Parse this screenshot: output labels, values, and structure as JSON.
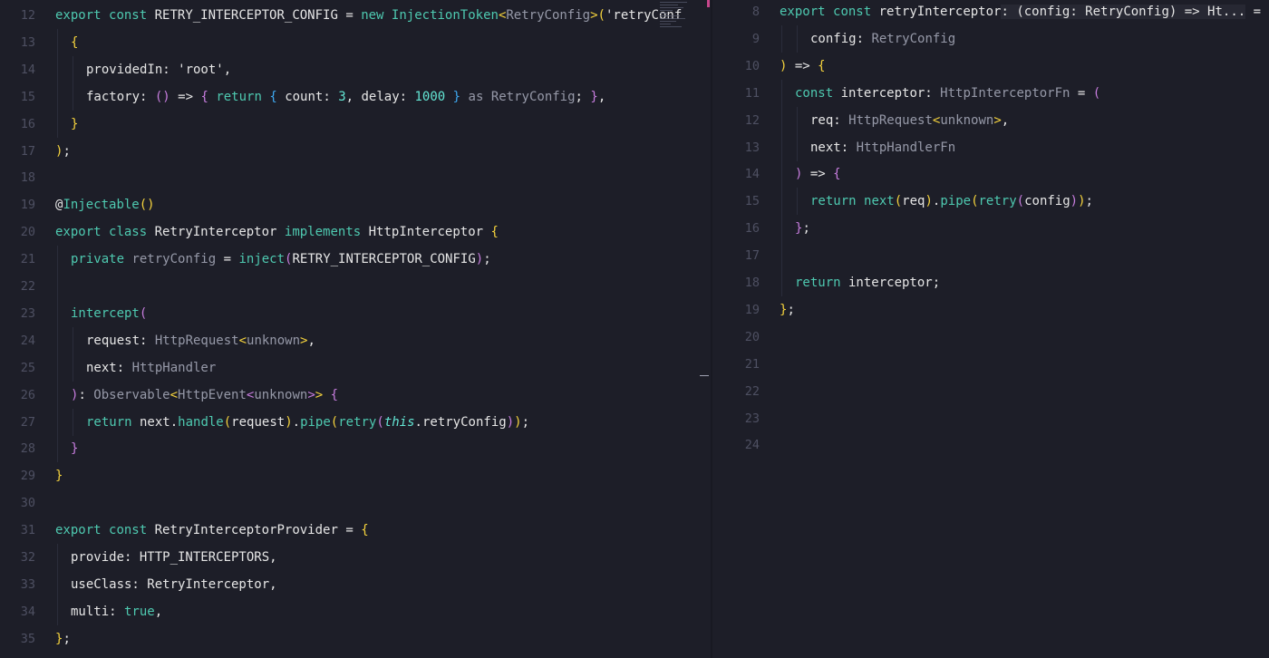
{
  "left_editor": {
    "lines": [
      {
        "n": "12",
        "ind": 0,
        "toks": [
          [
            "k",
            "export"
          ],
          [
            "v",
            " "
          ],
          [
            "k",
            "const"
          ],
          [
            "v",
            " RETRY_INTERCEPTOR_CONFIG = "
          ],
          [
            "k",
            "new"
          ],
          [
            "v",
            " "
          ],
          [
            "d",
            "InjectionToken"
          ],
          [
            "b1",
            "<"
          ],
          [
            "t",
            "RetryConfig"
          ],
          [
            "b1",
            ">"
          ],
          [
            "b1",
            "("
          ],
          [
            "v",
            "'retryConf"
          ]
        ]
      },
      {
        "n": "13",
        "ind": 1,
        "toks": [
          [
            "b1",
            "{"
          ]
        ]
      },
      {
        "n": "14",
        "ind": 2,
        "toks": [
          [
            "v",
            "providedIn: 'root',"
          ]
        ]
      },
      {
        "n": "15",
        "ind": 2,
        "toks": [
          [
            "v",
            "factory: "
          ],
          [
            "b2",
            "()"
          ],
          [
            "v",
            " => "
          ],
          [
            "b2",
            "{"
          ],
          [
            "v",
            " "
          ],
          [
            "k",
            "return"
          ],
          [
            "v",
            " "
          ],
          [
            "b3",
            "{"
          ],
          [
            "v",
            " count: "
          ],
          [
            "n",
            "3"
          ],
          [
            "v",
            ", delay: "
          ],
          [
            "n",
            "1000"
          ],
          [
            "v",
            " "
          ],
          [
            "b3",
            "}"
          ],
          [
            "v",
            " "
          ],
          [
            "t",
            "as RetryConfig"
          ],
          [
            "v",
            "; "
          ],
          [
            "b2",
            "}"
          ],
          [
            "v",
            ","
          ]
        ]
      },
      {
        "n": "16",
        "ind": 1,
        "toks": [
          [
            "b1",
            "}"
          ]
        ]
      },
      {
        "n": "17",
        "ind": 0,
        "toks": [
          [
            "b1",
            ")"
          ],
          [
            "v",
            ";"
          ]
        ]
      },
      {
        "n": "18",
        "ind": 0,
        "toks": []
      },
      {
        "n": "19",
        "ind": 0,
        "toks": [
          [
            "v",
            "@"
          ],
          [
            "d",
            "Injectable"
          ],
          [
            "b1",
            "()"
          ]
        ]
      },
      {
        "n": "20",
        "ind": 0,
        "toks": [
          [
            "k",
            "export"
          ],
          [
            "v",
            " "
          ],
          [
            "k",
            "class"
          ],
          [
            "v",
            " RetryInterceptor "
          ],
          [
            "k",
            "implements"
          ],
          [
            "v",
            " HttpInterceptor "
          ],
          [
            "b1",
            "{"
          ]
        ]
      },
      {
        "n": "21",
        "ind": 1,
        "toks": [
          [
            "k",
            "private"
          ],
          [
            "v",
            " "
          ],
          [
            "t",
            "retryConfig"
          ],
          [
            "v",
            " = "
          ],
          [
            "f",
            "inject"
          ],
          [
            "b2",
            "("
          ],
          [
            "v",
            "RETRY_INTERCEPTOR_CONFIG"
          ],
          [
            "b2",
            ")"
          ],
          [
            "v",
            ";"
          ]
        ]
      },
      {
        "n": "22",
        "ind": 1,
        "toks": []
      },
      {
        "n": "23",
        "ind": 1,
        "toks": [
          [
            "f",
            "intercept"
          ],
          [
            "b2",
            "("
          ]
        ]
      },
      {
        "n": "24",
        "ind": 2,
        "toks": [
          [
            "v",
            "request: "
          ],
          [
            "t",
            "HttpRequest"
          ],
          [
            "b1",
            "<"
          ],
          [
            "t",
            "unknown"
          ],
          [
            "b1",
            ">"
          ],
          [
            "v",
            ","
          ]
        ]
      },
      {
        "n": "25",
        "ind": 2,
        "toks": [
          [
            "v",
            "next: "
          ],
          [
            "t",
            "HttpHandler"
          ]
        ]
      },
      {
        "n": "26",
        "ind": 1,
        "toks": [
          [
            "b2",
            ")"
          ],
          [
            "v",
            ": "
          ],
          [
            "t",
            "Observable"
          ],
          [
            "b1",
            "<"
          ],
          [
            "t",
            "HttpEvent"
          ],
          [
            "b2",
            "<"
          ],
          [
            "t",
            "unknown"
          ],
          [
            "b2",
            ">"
          ],
          [
            "b1",
            ">"
          ],
          [
            "v",
            " "
          ],
          [
            "b2",
            "{"
          ]
        ]
      },
      {
        "n": "27",
        "ind": 2,
        "toks": [
          [
            "k",
            "return"
          ],
          [
            "v",
            " next."
          ],
          [
            "f",
            "handle"
          ],
          [
            "b1",
            "("
          ],
          [
            "v",
            "request"
          ],
          [
            "b1",
            ")"
          ],
          [
            "v",
            "."
          ],
          [
            "f",
            "pipe"
          ],
          [
            "b1",
            "("
          ],
          [
            "f",
            "retry"
          ],
          [
            "b2",
            "("
          ],
          [
            "it",
            "this"
          ],
          [
            "v",
            ".retryConfig"
          ],
          [
            "b2",
            ")"
          ],
          [
            "b1",
            ")"
          ],
          [
            "v",
            ";"
          ]
        ]
      },
      {
        "n": "28",
        "ind": 1,
        "toks": [
          [
            "b2",
            "}"
          ]
        ]
      },
      {
        "n": "29",
        "ind": 0,
        "toks": [
          [
            "b1",
            "}"
          ]
        ]
      },
      {
        "n": "30",
        "ind": 0,
        "toks": []
      },
      {
        "n": "31",
        "ind": 0,
        "toks": [
          [
            "k",
            "export"
          ],
          [
            "v",
            " "
          ],
          [
            "k",
            "const"
          ],
          [
            "v",
            " RetryInterceptorProvider = "
          ],
          [
            "b1",
            "{"
          ]
        ]
      },
      {
        "n": "32",
        "ind": 1,
        "toks": [
          [
            "v",
            "provide: HTTP_INTERCEPTORS,"
          ]
        ]
      },
      {
        "n": "33",
        "ind": 1,
        "toks": [
          [
            "v",
            "useClass: RetryInterceptor,"
          ]
        ]
      },
      {
        "n": "34",
        "ind": 1,
        "toks": [
          [
            "v",
            "multi: "
          ],
          [
            "k",
            "true"
          ],
          [
            "v",
            ","
          ]
        ]
      },
      {
        "n": "35",
        "ind": 0,
        "toks": [
          [
            "b1",
            "}"
          ],
          [
            "v",
            ";"
          ]
        ]
      }
    ]
  },
  "right_editor": {
    "lines": [
      {
        "n": "8",
        "ind": 0,
        "toks": [
          [
            "k",
            "export"
          ],
          [
            "v",
            " "
          ],
          [
            "k",
            "const"
          ],
          [
            "v",
            " retryInterceptor"
          ],
          [
            "hint",
            ": (config: RetryConfig) => Ht..."
          ],
          [
            "v",
            " = "
          ],
          [
            "b1",
            "("
          ]
        ]
      },
      {
        "n": "9",
        "ind": 2,
        "toks": [
          [
            "v",
            "config: "
          ],
          [
            "t",
            "RetryConfig"
          ]
        ]
      },
      {
        "n": "10",
        "ind": 0,
        "toks": [
          [
            "b1",
            ")"
          ],
          [
            "v",
            " => "
          ],
          [
            "b1",
            "{"
          ]
        ]
      },
      {
        "n": "11",
        "ind": 1,
        "toks": [
          [
            "k",
            "const"
          ],
          [
            "v",
            " interceptor: "
          ],
          [
            "t",
            "HttpInterceptorFn"
          ],
          [
            "v",
            " = "
          ],
          [
            "b2",
            "("
          ]
        ]
      },
      {
        "n": "12",
        "ind": 2,
        "toks": [
          [
            "v",
            "req: "
          ],
          [
            "t",
            "HttpRequest"
          ],
          [
            "b1",
            "<"
          ],
          [
            "t",
            "unknown"
          ],
          [
            "b1",
            ">"
          ],
          [
            "v",
            ","
          ]
        ]
      },
      {
        "n": "13",
        "ind": 2,
        "toks": [
          [
            "v",
            "next: "
          ],
          [
            "t",
            "HttpHandlerFn"
          ]
        ]
      },
      {
        "n": "14",
        "ind": 1,
        "toks": [
          [
            "b2",
            ")"
          ],
          [
            "v",
            " => "
          ],
          [
            "b2",
            "{"
          ]
        ]
      },
      {
        "n": "15",
        "ind": 2,
        "toks": [
          [
            "k",
            "return"
          ],
          [
            "v",
            " "
          ],
          [
            "f",
            "next"
          ],
          [
            "b1",
            "("
          ],
          [
            "v",
            "req"
          ],
          [
            "b1",
            ")"
          ],
          [
            "v",
            "."
          ],
          [
            "f",
            "pipe"
          ],
          [
            "b1",
            "("
          ],
          [
            "f",
            "retry"
          ],
          [
            "b2",
            "("
          ],
          [
            "v",
            "config"
          ],
          [
            "b2",
            ")"
          ],
          [
            "b1",
            ")"
          ],
          [
            "v",
            ";"
          ]
        ]
      },
      {
        "n": "16",
        "ind": 1,
        "toks": [
          [
            "b2",
            "}"
          ],
          [
            "v",
            ";"
          ]
        ]
      },
      {
        "n": "17",
        "ind": 1,
        "toks": []
      },
      {
        "n": "18",
        "ind": 1,
        "toks": [
          [
            "k",
            "return"
          ],
          [
            "v",
            " interceptor;"
          ]
        ]
      },
      {
        "n": "19",
        "ind": 0,
        "toks": [
          [
            "b1",
            "}"
          ],
          [
            "v",
            ";"
          ]
        ]
      },
      {
        "n": "20",
        "ind": 0,
        "toks": []
      },
      {
        "n": "21",
        "ind": 0,
        "toks": []
      },
      {
        "n": "22",
        "ind": 0,
        "toks": []
      },
      {
        "n": "23",
        "ind": 0,
        "toks": []
      },
      {
        "n": "24",
        "ind": 0,
        "toks": []
      }
    ]
  },
  "colors": {
    "background": "#1d1e28",
    "keyword": "#4ec9b0",
    "type": "#9699a8",
    "number": "#63e6d4",
    "bracket_1": "#f5d33d",
    "bracket_2": "#c77dde",
    "bracket_3": "#3ea8f0",
    "line_number": "#4e5062"
  }
}
